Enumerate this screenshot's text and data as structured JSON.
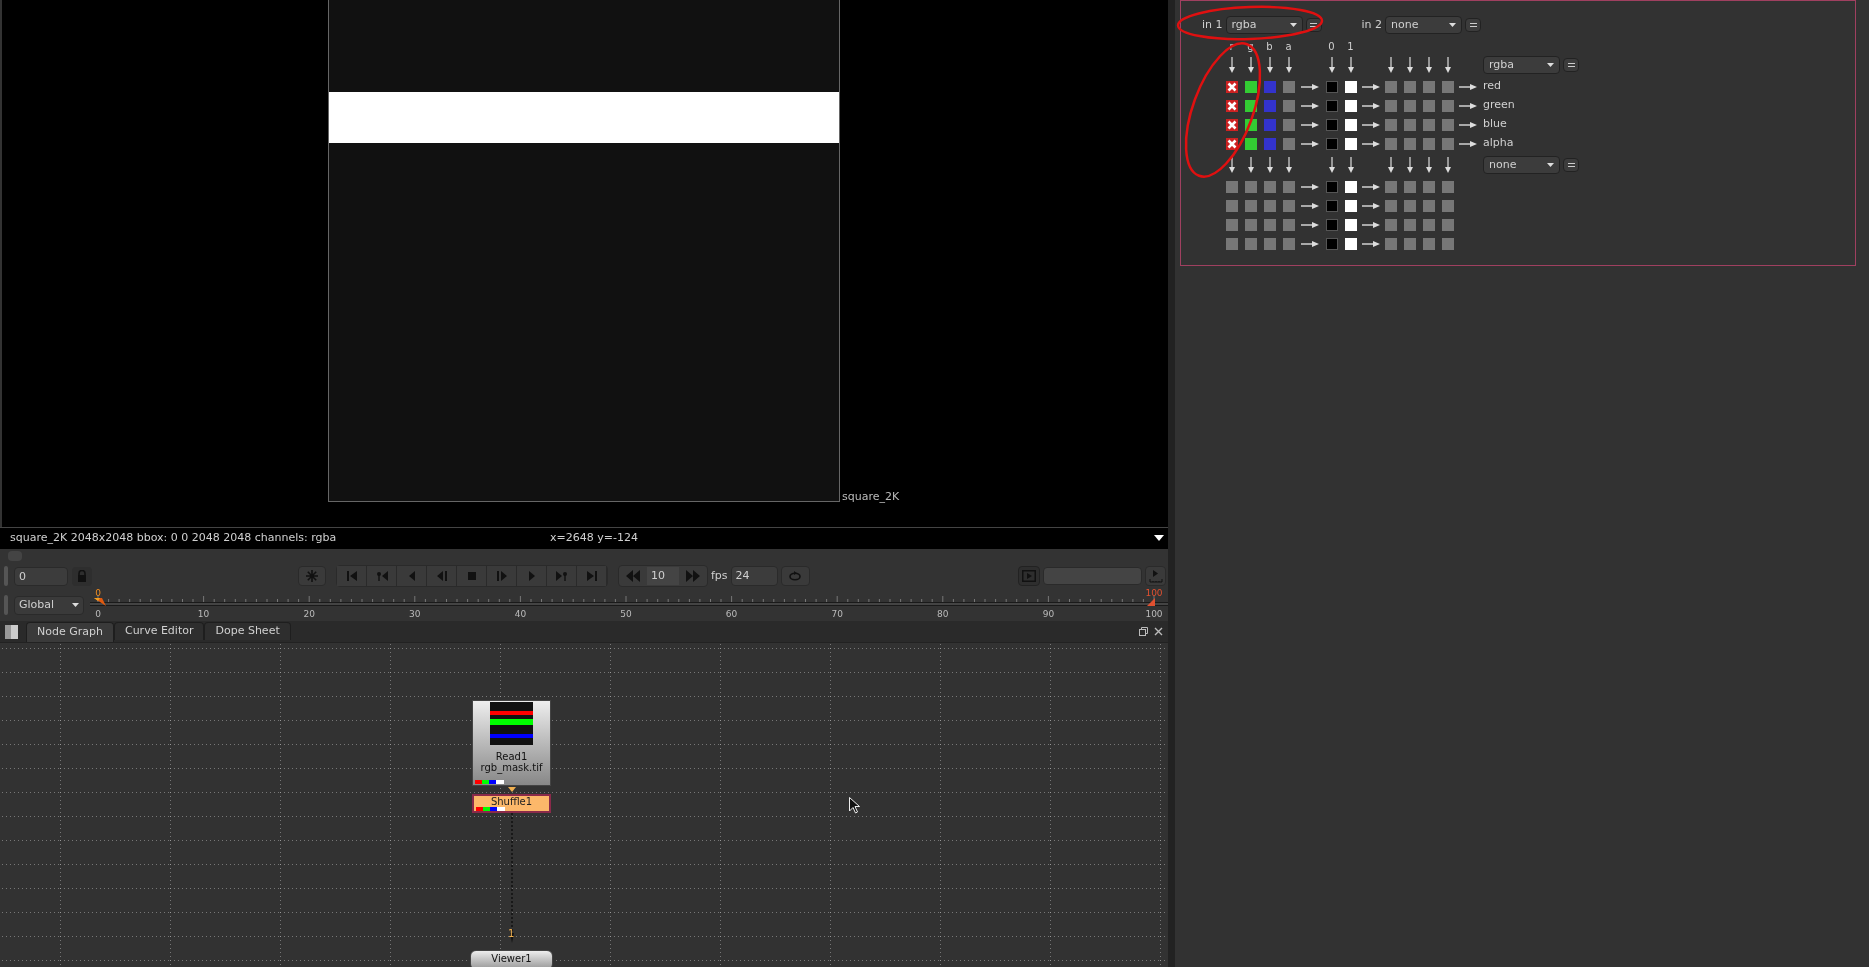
{
  "viewer": {
    "image_label": "square_2K",
    "info": "square_2K 2048x2048 bbox: 0 0 2048 2048 channels: rgba",
    "coordinates": "x=2648 y=-124"
  },
  "playback": {
    "frame": "0",
    "increment": "10",
    "fps_label": "fps",
    "fps": "24",
    "scope": "Global"
  },
  "timeline": {
    "ticks": [
      "0",
      "10",
      "20",
      "30",
      "40",
      "50",
      "60",
      "70",
      "80",
      "90",
      "100"
    ],
    "current_frame": "0",
    "end_frame": "100"
  },
  "tabs": [
    {
      "label": "Node Graph",
      "selected": true
    },
    {
      "label": "Curve Editor",
      "selected": false
    },
    {
      "label": "Dope Sheet",
      "selected": false
    }
  ],
  "nodes": [
    {
      "kind": "read",
      "label": "Read1",
      "file": "rgb_mask.tif",
      "selected": false
    },
    {
      "kind": "shuffle",
      "label": "Shuffle1",
      "selected": true
    },
    {
      "kind": "viewer",
      "label": "Viewer1",
      "input": "1",
      "selected": false
    }
  ],
  "shuffle": {
    "in1_label": "in 1",
    "in1": "rgba",
    "in2_label": "in 2",
    "in2": "none",
    "input_columns": [
      {
        "label": "r",
        "color": "#cc2222"
      },
      {
        "label": "g",
        "color": "#33cc33"
      },
      {
        "label": "b",
        "color": "#3333cc"
      },
      {
        "label": "a"
      }
    ],
    "const_columns": [
      "0",
      "1"
    ],
    "out1": "rgba",
    "out2": "none",
    "top_rows": [
      {
        "name": "red",
        "cells": [
          {
            "checked": true,
            "crossed": true
          },
          {
            "checked": true,
            "crossed": false
          },
          {
            "checked": true,
            "crossed": false
          },
          {
            "checked": false,
            "crossed": false
          }
        ]
      },
      {
        "name": "green",
        "cells": [
          {
            "checked": true,
            "crossed": true
          },
          {
            "checked": true,
            "crossed": false
          },
          {
            "checked": true,
            "crossed": false
          },
          {
            "checked": false,
            "crossed": false
          }
        ]
      },
      {
        "name": "blue",
        "cells": [
          {
            "checked": true,
            "crossed": true
          },
          {
            "checked": true,
            "crossed": false
          },
          {
            "checked": true,
            "crossed": false
          },
          {
            "checked": false,
            "crossed": false
          }
        ]
      },
      {
        "name": "alpha",
        "cells": [
          {
            "checked": true,
            "crossed": true
          },
          {
            "checked": true,
            "crossed": false
          },
          {
            "checked": true,
            "crossed": false
          },
          {
            "checked": false,
            "crossed": false
          }
        ]
      }
    ],
    "bottom_rows": [
      {
        "cells": [
          {
            "checked": false,
            "crossed": false
          },
          {
            "checked": false,
            "crossed": false
          },
          {
            "checked": false,
            "crossed": false
          },
          {
            "checked": false,
            "crossed": false
          }
        ]
      },
      {
        "cells": [
          {
            "checked": false,
            "crossed": false
          },
          {
            "checked": false,
            "crossed": false
          },
          {
            "checked": false,
            "crossed": false
          },
          {
            "checked": false,
            "crossed": false
          }
        ]
      },
      {
        "cells": [
          {
            "checked": false,
            "crossed": false
          },
          {
            "checked": false,
            "crossed": false
          },
          {
            "checked": false,
            "crossed": false
          },
          {
            "checked": false,
            "crossed": false
          }
        ]
      },
      {
        "cells": [
          {
            "checked": false,
            "crossed": false
          },
          {
            "checked": false,
            "crossed": false
          },
          {
            "checked": false,
            "crossed": false
          },
          {
            "checked": false,
            "crossed": false
          }
        ]
      }
    ]
  }
}
